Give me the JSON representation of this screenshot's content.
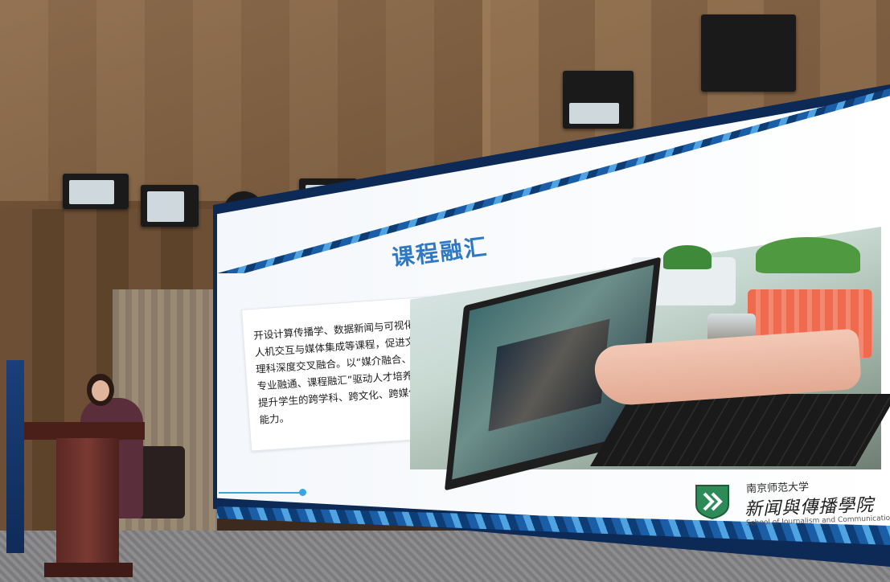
{
  "slide": {
    "title": "课程融汇",
    "body_lines": [
      "开设计算传播学、数据新闻与可视化、",
      "人机交互与媒体集成等课程，促进文",
      "理科深度交叉融合。以“媒介融合、",
      "专业融通、课程融汇”驱动人才培养，",
      "提升学生的跨学科、跨文化、跨媒体",
      "能力。"
    ],
    "footer": {
      "university": "南京师范大学",
      "school_cn": "新闻與傳播學院",
      "school_en": "School of Journalism and Communication"
    }
  },
  "colors": {
    "title": "#2f79c4",
    "accent": "#3aa6e0",
    "stripe_dark": "#0e3c75",
    "stripe_light": "#4fa3e0"
  }
}
